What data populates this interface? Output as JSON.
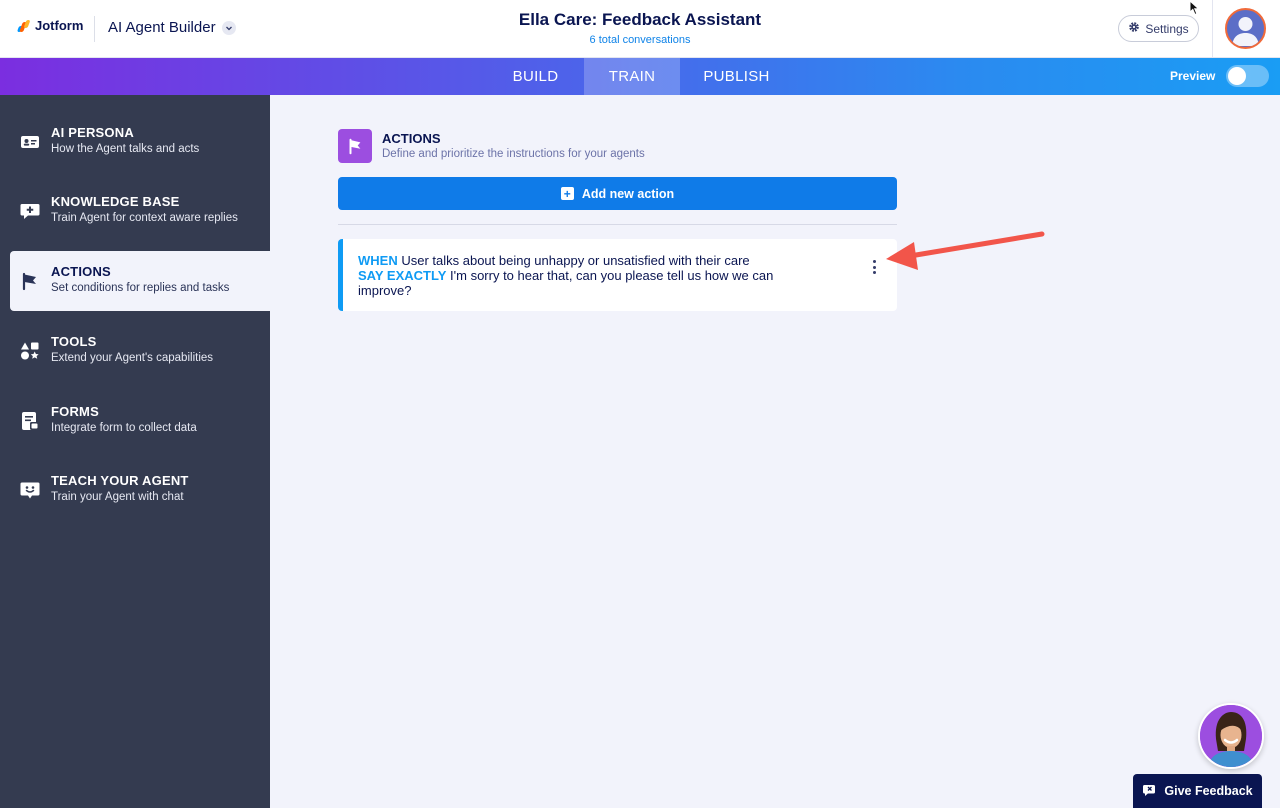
{
  "header": {
    "logo_text": "Jotform",
    "builder_label": "AI Agent Builder",
    "title": "Ella Care: Feedback Assistant",
    "subtitle": "6 total conversations",
    "settings_label": "Settings"
  },
  "nav": {
    "tabs": [
      {
        "label": "BUILD",
        "active": false
      },
      {
        "label": "TRAIN",
        "active": true
      },
      {
        "label": "PUBLISH",
        "active": false
      }
    ],
    "preview_label": "Preview",
    "preview_on": false
  },
  "sidebar": {
    "items": [
      {
        "title": "AI PERSONA",
        "desc": "How the Agent talks and acts",
        "icon": "id-card-icon"
      },
      {
        "title": "KNOWLEDGE BASE",
        "desc": "Train Agent for context aware replies",
        "icon": "chat-plus-icon"
      },
      {
        "title": "ACTIONS",
        "desc": "Set conditions for replies and tasks",
        "icon": "flag-icon",
        "active": true
      },
      {
        "title": "TOOLS",
        "desc": "Extend your Agent's capabilities",
        "icon": "shapes-icon"
      },
      {
        "title": "FORMS",
        "desc": "Integrate form to collect data",
        "icon": "form-icon"
      },
      {
        "title": "TEACH YOUR AGENT",
        "desc": "Train your Agent with chat",
        "icon": "smile-chat-icon"
      }
    ]
  },
  "main": {
    "title": "ACTIONS",
    "description": "Define and prioritize the instructions for your agents",
    "add_button_label": "Add new action",
    "actions": [
      {
        "when_keyword": "WHEN",
        "when_text": "User talks about being unhappy or unsatisfied with their care",
        "say_keyword": "SAY EXACTLY",
        "say_text_line1": "I'm sorry to hear that, can you please tell us how we can",
        "say_text_line2": "improve?"
      }
    ]
  },
  "feedback": {
    "button_label": "Give Feedback"
  },
  "colors": {
    "brand_navy": "#0a1551",
    "primary_blue": "#0f7be8",
    "accent_cyan": "#0f9bf4",
    "actions_purple": "#9c4ee0",
    "sidebar_bg": "#343b50",
    "annotation_arrow": "#f2554a"
  }
}
